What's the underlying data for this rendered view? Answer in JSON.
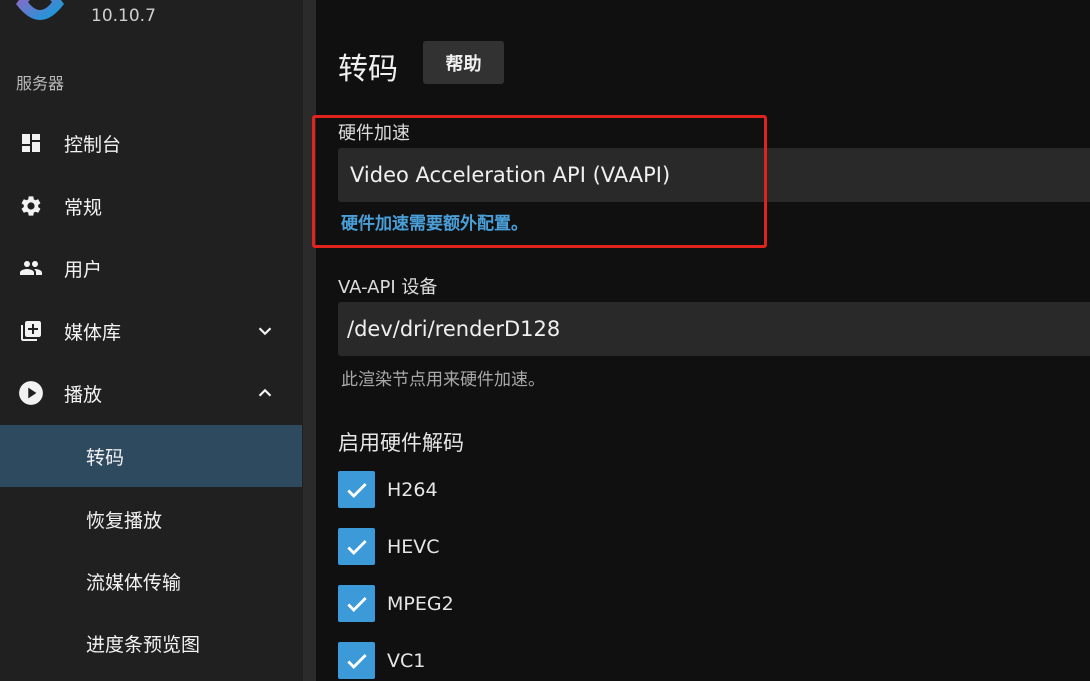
{
  "app": {
    "version": "10.10.7"
  },
  "sidebar": {
    "section_title": "服务器",
    "items": [
      {
        "label": "控制台",
        "icon": "dashboard-icon"
      },
      {
        "label": "常规",
        "icon": "gear-icon"
      },
      {
        "label": "用户",
        "icon": "users-icon"
      },
      {
        "label": "媒体库",
        "icon": "library-add-icon",
        "expanded": false
      },
      {
        "label": "播放",
        "icon": "play-circle-icon",
        "expanded": true
      }
    ],
    "sub_items": [
      {
        "label": "转码",
        "active": true
      },
      {
        "label": "恢复播放"
      },
      {
        "label": "流媒体传输"
      },
      {
        "label": "进度条预览图"
      }
    ]
  },
  "main": {
    "title": "转码",
    "help_label": "帮助",
    "hw_accel": {
      "label": "硬件加速",
      "value": "Video Acceleration API (VAAPI)",
      "hint": "硬件加速需要额外配置。"
    },
    "vaapi_device": {
      "label": "VA-API 设备",
      "value": "/dev/dri/renderD128",
      "hint": "此渲染节点用来硬件加速。"
    },
    "hw_decoding": {
      "title": "启用硬件解码",
      "codecs": [
        {
          "label": "H264",
          "checked": true
        },
        {
          "label": "HEVC",
          "checked": true
        },
        {
          "label": "MPEG2",
          "checked": true
        },
        {
          "label": "VC1",
          "checked": true
        }
      ]
    }
  },
  "colors": {
    "accent": "#3d9ad8",
    "link": "#4a9fd8",
    "highlight": "#e0231c",
    "active_item": "#2e4a5e"
  }
}
